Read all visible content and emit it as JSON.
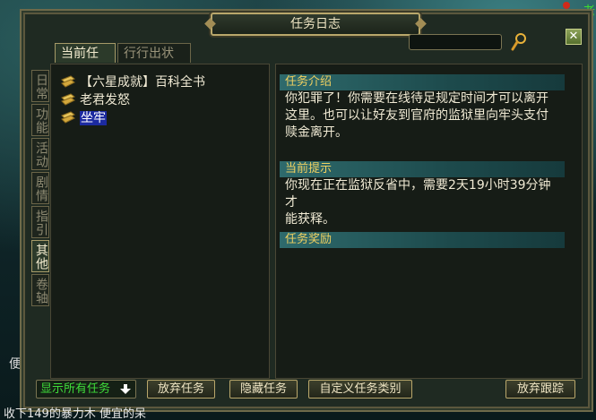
{
  "window": {
    "title": "任务日志"
  },
  "search": {
    "value": ""
  },
  "tabs": [
    "当前任务",
    "行行出状元"
  ],
  "side_tabs": [
    "日常",
    "功能",
    "活动",
    "剧情",
    "指引",
    "其他",
    "卷轴"
  ],
  "active_side_tab": "其他",
  "quests": [
    {
      "label": "【六星成就】百科全书",
      "selected": false
    },
    {
      "label": "老君发怒",
      "selected": false
    },
    {
      "label": "坐牢",
      "selected": true
    }
  ],
  "details": {
    "intro_heading": "任务介绍",
    "intro_lines": [
      "你犯罪了！你需要在线待足规定时间才可以离开",
      "这里。也可以让好友到官府的监狱里向牢头支付",
      "赎金离开。"
    ],
    "hint_heading": "当前提示",
    "hint_lines": [
      "你现在正在监狱反省中，需要2天19小时39分钟才",
      "能获释。"
    ],
    "reward_heading": "任务奖励"
  },
  "footer": {
    "filter_label": "显示所有任务",
    "abandon_label": "放弃任务",
    "hide_label": "隐藏任务",
    "custom_label": "自定义任务类别",
    "untrack_label": "放弃跟踪"
  },
  "scene": {
    "side_text": "便",
    "ticker": "收下149的暴力木   便宜的呆",
    "corner_text": "老"
  },
  "colors": {
    "accent_gold": "#b9a76b",
    "heading_yellow": "#f0d060",
    "filter_green": "#3fdc3a",
    "selection_blue": "#1c2aa0"
  }
}
